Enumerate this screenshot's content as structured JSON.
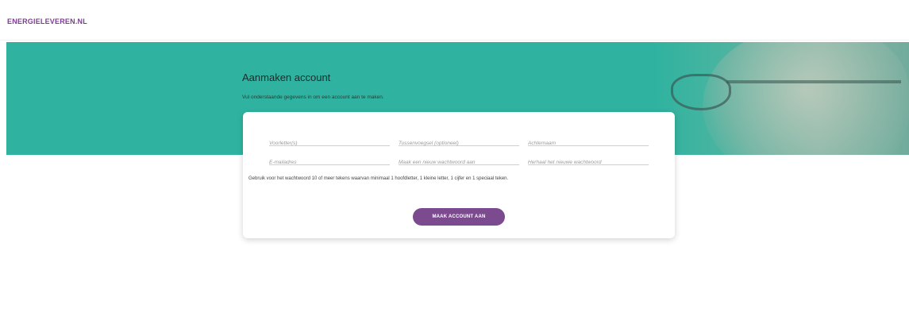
{
  "header": {
    "logo_text": "ENERGIELEVEREN.NL"
  },
  "hero": {
    "title": "Aanmaken account",
    "subtitle": "Vul onderstaande gegevens in om een account aan te maken."
  },
  "form": {
    "fields": [
      {
        "placeholder": "Voorletter(s)",
        "value": ""
      },
      {
        "placeholder": "Tussenvoegsel (optioneel)",
        "value": ""
      },
      {
        "placeholder": "Achternaam",
        "value": ""
      },
      {
        "placeholder": "E-mailadres",
        "value": ""
      },
      {
        "placeholder": "Maak een nieuw wachtwoord aan",
        "value": ""
      },
      {
        "placeholder": "Herhaal het nieuwe wachtwoord",
        "value": ""
      }
    ],
    "password_hint": "Gebruik voor het wachtwoord 10 of meer tekens waarvan minimaal 1 hoofdletter, 1 kleine letter, 1 cijfer en 1 speciaal teken.",
    "submit_label": "MAAK ACCOUNT AAN"
  },
  "colors": {
    "brand_purple": "#7b4a8f",
    "hero_teal": "#2fb3a0"
  }
}
